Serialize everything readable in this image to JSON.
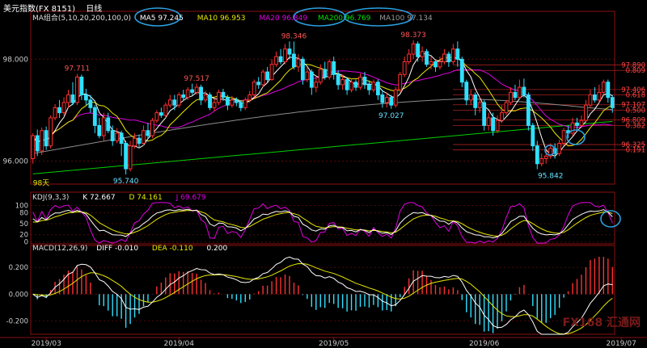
{
  "header": {
    "title": "美元指数(FX 8151)",
    "period": "日线"
  },
  "ma_legend": [
    {
      "label": "MA组合(5,10,20,200,100,0)",
      "color": "#dddddd"
    },
    {
      "label": "MA5 97.245",
      "color": "#ffffff"
    },
    {
      "label": "MA10 96.953",
      "color": "#e8e800"
    },
    {
      "label": "MA20 96.849",
      "color": "#e000e0"
    },
    {
      "label": "MA200 96.769",
      "color": "#00e000"
    },
    {
      "label": "MA100 97.134",
      "color": "#9a9a9a"
    }
  ],
  "kdj_legend": [
    {
      "label": "KDJ(9,3,3)",
      "color": "#dddddd"
    },
    {
      "label": "K 72.667",
      "color": "#ffffff"
    },
    {
      "label": "D 74.161",
      "color": "#e8e800"
    },
    {
      "label": "J 69.679",
      "color": "#e000e0"
    }
  ],
  "macd_legend": [
    {
      "label": "MACD(12,26,9)",
      "color": "#dddddd"
    },
    {
      "label": "DIFF -0.010",
      "color": "#ffffff"
    },
    {
      "label": "DEA -0.110",
      "color": "#e8e800"
    },
    {
      "label": "0.200",
      "color": "#ffffff"
    }
  ],
  "watermark": "FX168 汇通网",
  "chart_data": {
    "type": "candlestick",
    "price_axis": {
      "ticks": [
        "98.000",
        "96.000"
      ],
      "ylim": [
        95.55,
        98.75
      ]
    },
    "kdj_axis": {
      "ticks": [
        "100",
        "80",
        "50",
        "20",
        "0"
      ],
      "ylim": [
        -5,
        110
      ]
    },
    "macd_axis": {
      "ticks": [
        "0.200",
        "0.000",
        "-0.200"
      ],
      "ylim": [
        -0.3,
        0.28
      ]
    },
    "x_labels": [
      "2019/03",
      "2019/04",
      "2019/05",
      "2019/06",
      "2019/07"
    ],
    "x_label_index": [
      3,
      33,
      68,
      102,
      133
    ],
    "annotations": [
      {
        "text": "97.711",
        "i": 10,
        "v": 97.711,
        "pos": "above",
        "color": "#ff5555"
      },
      {
        "text": "95.740",
        "i": 21,
        "v": 95.74,
        "pos": "below",
        "color": "#66e0ff"
      },
      {
        "text": "97.517",
        "i": 37,
        "v": 97.517,
        "pos": "above",
        "color": "#ff5555"
      },
      {
        "text": "98.346",
        "i": 59,
        "v": 98.346,
        "pos": "above",
        "color": "#ff5555"
      },
      {
        "text": "97.027",
        "i": 81,
        "v": 97.027,
        "pos": "below",
        "color": "#66e0ff"
      },
      {
        "text": "98.373",
        "i": 86,
        "v": 98.373,
        "pos": "above",
        "color": "#ff5555"
      },
      {
        "text": "95.842",
        "i": 117,
        "v": 95.842,
        "pos": "below",
        "color": "#66e0ff"
      },
      {
        "text": "98天",
        "i": 0,
        "v": 95.7,
        "pos": "below",
        "color": "#e8e800"
      }
    ],
    "fib_levels": [
      {
        "text": "97.890",
        "v": 97.89
      },
      {
        "text": "0.809",
        "v": 97.78
      },
      {
        "text": "97.406",
        "v": 97.406
      },
      {
        "text": "0.618",
        "v": 97.3
      },
      {
        "text": "97.107",
        "v": 97.107
      },
      {
        "text": "0.500",
        "v": 97.0
      },
      {
        "text": "96.809",
        "v": 96.809
      },
      {
        "text": "0.382",
        "v": 96.7
      },
      {
        "text": "96.325",
        "v": 96.325
      },
      {
        "text": "0.191",
        "v": 96.22
      }
    ],
    "candles": [
      [
        96.05,
        96.5,
        96.55,
        95.95
      ],
      [
        96.5,
        96.2,
        96.62,
        96.1
      ],
      [
        96.2,
        96.6,
        96.66,
        96.12
      ],
      [
        96.6,
        96.3,
        96.68,
        96.22
      ],
      [
        96.3,
        96.85,
        96.9,
        96.25
      ],
      [
        96.85,
        97.05,
        97.12,
        96.8
      ],
      [
        97.05,
        96.95,
        97.2,
        96.85
      ],
      [
        96.95,
        97.15,
        97.25,
        96.9
      ],
      [
        97.15,
        97.3,
        97.4,
        97.05
      ],
      [
        97.3,
        97.15,
        97.55,
        97.1
      ],
      [
        97.15,
        97.65,
        97.71,
        97.1
      ],
      [
        97.65,
        97.3,
        97.7,
        97.2
      ],
      [
        97.3,
        97.2,
        97.42,
        97.1
      ],
      [
        97.2,
        97.05,
        97.3,
        96.95
      ],
      [
        97.05,
        96.7,
        97.1,
        96.55
      ],
      [
        96.7,
        96.5,
        96.85,
        96.45
      ],
      [
        96.5,
        96.85,
        96.95,
        96.4
      ],
      [
        96.85,
        96.6,
        96.95,
        96.55
      ],
      [
        96.6,
        96.4,
        96.7,
        96.3
      ],
      [
        96.4,
        96.55,
        96.65,
        96.35
      ],
      [
        96.55,
        96.35,
        96.6,
        96.1
      ],
      [
        96.35,
        95.85,
        96.4,
        95.74
      ],
      [
        95.85,
        96.3,
        96.4,
        95.8
      ],
      [
        96.3,
        96.45,
        96.55,
        96.25
      ],
      [
        96.45,
        96.35,
        96.52,
        96.28
      ],
      [
        96.35,
        96.6,
        96.7,
        96.3
      ],
      [
        96.6,
        96.5,
        96.75,
        96.45
      ],
      [
        96.5,
        96.8,
        96.85,
        96.45
      ],
      [
        96.8,
        96.95,
        97.0,
        96.75
      ],
      [
        96.95,
        96.9,
        97.05,
        96.85
      ],
      [
        96.9,
        97.1,
        97.15,
        96.85
      ],
      [
        97.1,
        97.2,
        97.3,
        97.05
      ],
      [
        97.2,
        97.1,
        97.3,
        97.0
      ],
      [
        97.1,
        97.3,
        97.35,
        97.05
      ],
      [
        97.3,
        97.25,
        97.4,
        97.18
      ],
      [
        97.25,
        97.4,
        97.45,
        97.2
      ],
      [
        97.4,
        97.35,
        97.52,
        97.3
      ],
      [
        97.35,
        97.45,
        97.52,
        97.3
      ],
      [
        97.45,
        97.2,
        97.5,
        97.1
      ],
      [
        97.2,
        97.3,
        97.38,
        97.15
      ],
      [
        97.3,
        97.05,
        97.35,
        97.0
      ],
      [
        97.05,
        97.15,
        97.22,
        96.98
      ],
      [
        97.15,
        97.35,
        97.4,
        97.1
      ],
      [
        97.35,
        97.25,
        97.42,
        97.18
      ],
      [
        97.25,
        97.1,
        97.3,
        97.0
      ],
      [
        97.1,
        97.2,
        97.28,
        97.05
      ],
      [
        97.2,
        97.15,
        97.25,
        97.08
      ],
      [
        97.15,
        97.05,
        97.2,
        96.98
      ],
      [
        97.05,
        97.2,
        97.25,
        97.0
      ],
      [
        97.2,
        97.3,
        97.38,
        97.15
      ],
      [
        97.3,
        97.55,
        97.6,
        97.25
      ],
      [
        97.55,
        97.5,
        97.65,
        97.42
      ],
      [
        97.5,
        97.75,
        97.8,
        97.45
      ],
      [
        97.75,
        97.6,
        97.85,
        97.55
      ],
      [
        97.6,
        97.9,
        98.0,
        97.58
      ],
      [
        97.9,
        98.05,
        98.15,
        97.85
      ],
      [
        98.05,
        97.95,
        98.2,
        97.9
      ],
      [
        97.95,
        98.2,
        98.3,
        97.9
      ],
      [
        98.2,
        98.1,
        98.35,
        98.0
      ],
      [
        98.1,
        97.85,
        98.346,
        97.8
      ],
      [
        97.85,
        98.0,
        98.1,
        97.75
      ],
      [
        98.0,
        97.6,
        98.05,
        97.5
      ],
      [
        97.6,
        97.75,
        97.85,
        97.55
      ],
      [
        97.75,
        97.45,
        97.8,
        97.3
      ],
      [
        97.45,
        97.55,
        97.65,
        97.35
      ],
      [
        97.55,
        97.8,
        97.9,
        97.5
      ],
      [
        97.8,
        97.65,
        97.95,
        97.6
      ],
      [
        97.65,
        97.95,
        98.0,
        97.6
      ],
      [
        97.95,
        97.7,
        98.05,
        97.6
      ],
      [
        97.7,
        97.5,
        97.78,
        97.4
      ],
      [
        97.5,
        97.6,
        97.7,
        97.4
      ],
      [
        97.6,
        97.4,
        97.65,
        97.3
      ],
      [
        97.4,
        97.55,
        97.62,
        97.35
      ],
      [
        97.55,
        97.45,
        97.6,
        97.38
      ],
      [
        97.45,
        97.65,
        97.72,
        97.4
      ],
      [
        97.65,
        97.5,
        97.75,
        97.42
      ],
      [
        97.5,
        97.4,
        97.58,
        97.3
      ],
      [
        97.4,
        97.55,
        97.6,
        97.35
      ],
      [
        97.55,
        97.3,
        97.6,
        97.2
      ],
      [
        97.3,
        97.15,
        97.4,
        97.05
      ],
      [
        97.15,
        97.25,
        97.35,
        97.05
      ],
      [
        97.25,
        97.1,
        97.3,
        97.027
      ],
      [
        97.1,
        97.4,
        97.45,
        97.05
      ],
      [
        97.4,
        97.7,
        97.75,
        97.35
      ],
      [
        97.7,
        97.95,
        98.05,
        97.65
      ],
      [
        97.95,
        98.1,
        98.2,
        97.9
      ],
      [
        98.1,
        98.3,
        98.373,
        98.0
      ],
      [
        98.3,
        98.05,
        98.35,
        97.95
      ],
      [
        98.05,
        98.15,
        98.25,
        97.95
      ],
      [
        98.15,
        97.9,
        98.2,
        97.85
      ],
      [
        97.9,
        97.95,
        98.05,
        97.8
      ],
      [
        97.95,
        97.85,
        98.0,
        97.75
      ],
      [
        97.85,
        97.95,
        98.05,
        97.8
      ],
      [
        97.95,
        98.1,
        98.2,
        97.9
      ],
      [
        98.1,
        97.95,
        98.15,
        97.85
      ],
      [
        97.95,
        98.2,
        98.3,
        97.9
      ],
      [
        98.2,
        98.0,
        98.35,
        97.85
      ],
      [
        98.0,
        97.55,
        98.05,
        97.45
      ],
      [
        97.55,
        97.2,
        97.6,
        97.1
      ],
      [
        97.2,
        97.3,
        97.4,
        97.1
      ],
      [
        97.3,
        97.05,
        97.35,
        96.9
      ],
      [
        97.05,
        97.15,
        97.25,
        96.95
      ],
      [
        97.15,
        96.7,
        97.2,
        96.6
      ],
      [
        96.7,
        96.85,
        96.95,
        96.6
      ],
      [
        96.85,
        96.6,
        96.95,
        96.5
      ],
      [
        96.6,
        96.8,
        96.9,
        96.55
      ],
      [
        96.8,
        96.95,
        97.1,
        96.75
      ],
      [
        96.95,
        97.15,
        97.2,
        96.9
      ],
      [
        97.15,
        97.35,
        97.45,
        97.1
      ],
      [
        97.35,
        97.25,
        97.5,
        97.2
      ],
      [
        97.25,
        97.45,
        97.6,
        97.2
      ],
      [
        97.45,
        97.3,
        97.62,
        97.25
      ],
      [
        97.3,
        96.7,
        97.35,
        96.6
      ],
      [
        96.7,
        96.3,
        96.75,
        96.2
      ],
      [
        96.3,
        95.95,
        96.4,
        95.842
      ],
      [
        95.95,
        96.05,
        96.15,
        95.9
      ],
      [
        96.05,
        96.1,
        96.2,
        95.95
      ],
      [
        96.1,
        96.25,
        96.35,
        96.05
      ],
      [
        96.25,
        96.15,
        96.35,
        96.05
      ],
      [
        96.15,
        96.35,
        96.42,
        96.1
      ],
      [
        96.35,
        96.6,
        96.65,
        96.3
      ],
      [
        96.6,
        96.55,
        96.7,
        96.45
      ],
      [
        96.55,
        96.75,
        96.85,
        96.5
      ],
      [
        96.75,
        96.7,
        96.85,
        96.62
      ],
      [
        96.7,
        96.8,
        96.9,
        96.65
      ],
      [
        96.8,
        97.1,
        97.2,
        96.75
      ],
      [
        97.1,
        97.3,
        97.4,
        97.05
      ],
      [
        97.3,
        97.2,
        97.45,
        97.15
      ],
      [
        97.2,
        97.35,
        97.5,
        97.15
      ],
      [
        97.35,
        97.55,
        97.6,
        97.3
      ],
      [
        97.55,
        97.25,
        97.6,
        97.15
      ],
      [
        97.25,
        97.05,
        97.3,
        96.95
      ]
    ]
  }
}
